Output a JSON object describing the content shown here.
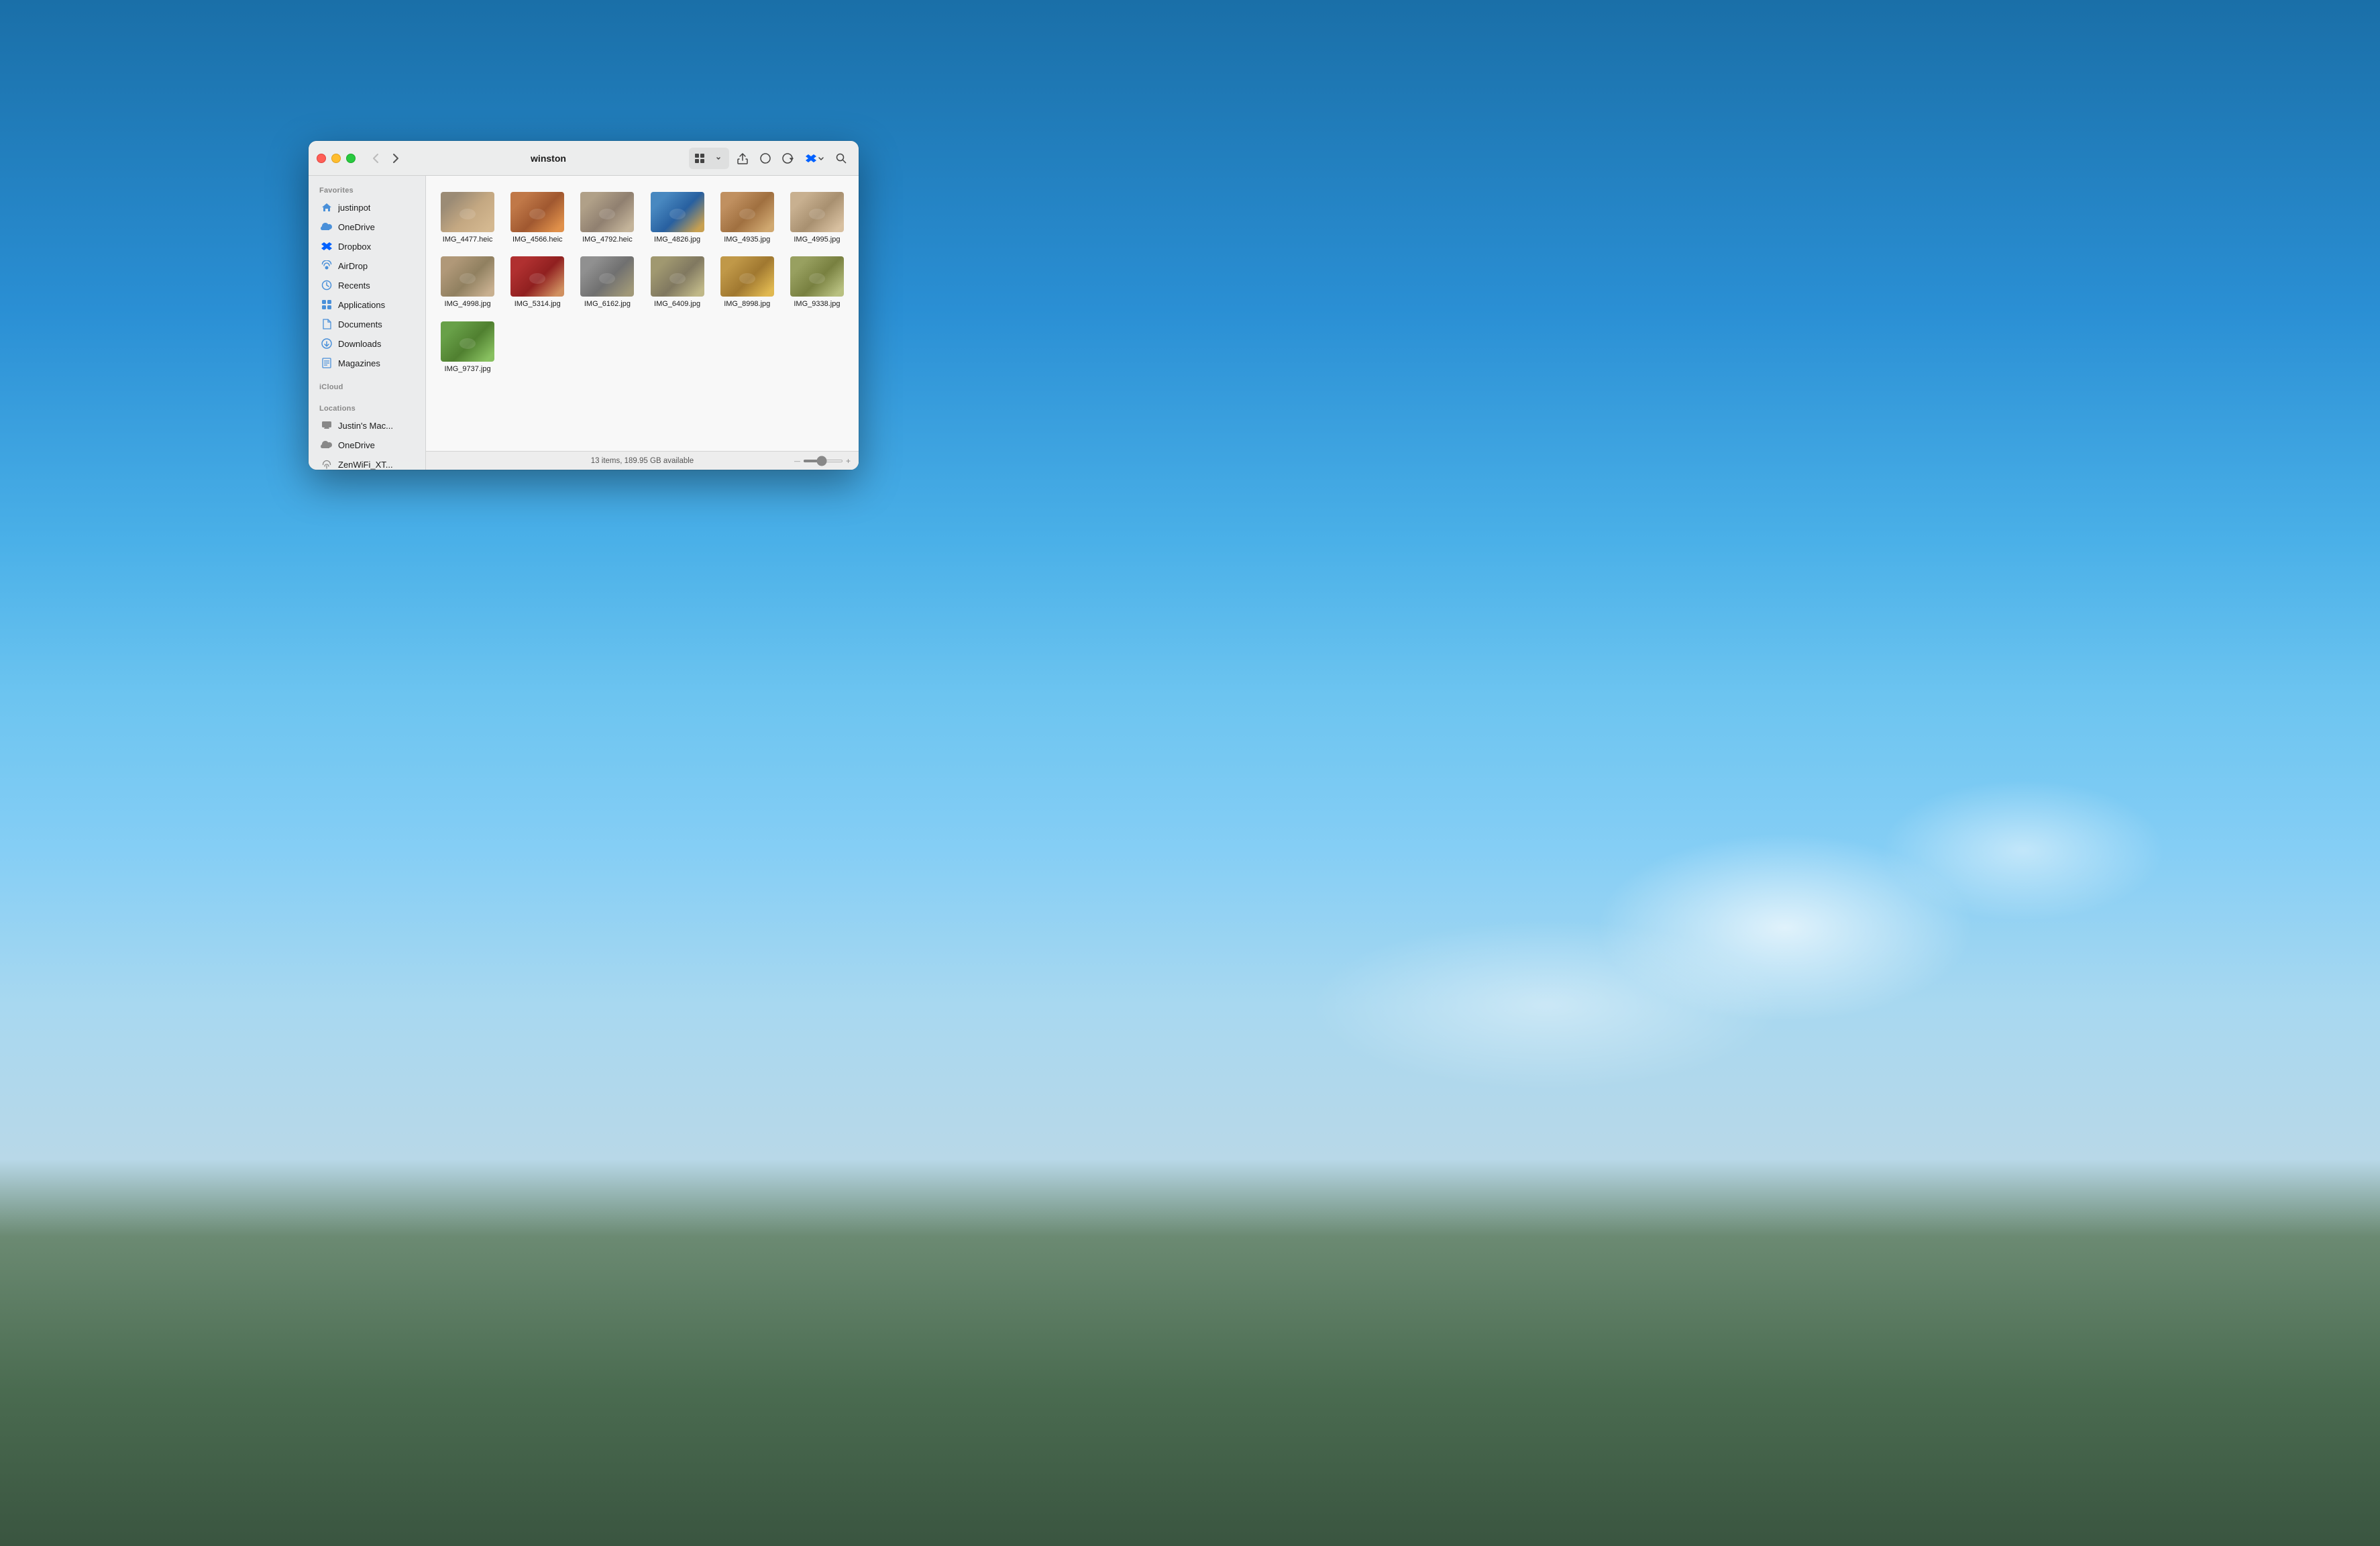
{
  "desktop": {
    "bg": "macOS desktop with ocean/sky scene"
  },
  "finder": {
    "title": "winston",
    "toolbar": {
      "back_label": "‹",
      "forward_label": "›",
      "view_grid_label": "⊞",
      "share_label": "↑",
      "tag_label": "⊙",
      "action_label": "…",
      "dropbox_label": "Dropbox",
      "search_label": "🔍"
    },
    "sidebar": {
      "favorites_label": "Favorites",
      "items": [
        {
          "id": "justinpot",
          "label": "justinpot",
          "icon": "🏠",
          "icon_color": "blue"
        },
        {
          "id": "onedrive",
          "label": "OneDrive",
          "icon": "☁",
          "icon_color": "blue"
        },
        {
          "id": "dropbox",
          "label": "Dropbox",
          "icon": "◈",
          "icon_color": "blue"
        },
        {
          "id": "airdrop",
          "label": "AirDrop",
          "icon": "📡",
          "icon_color": "blue"
        },
        {
          "id": "recents",
          "label": "Recents",
          "icon": "🕐",
          "icon_color": "blue"
        },
        {
          "id": "applications",
          "label": "Applications",
          "icon": "▦",
          "icon_color": "blue"
        },
        {
          "id": "documents",
          "label": "Documents",
          "icon": "📄",
          "icon_color": "blue"
        },
        {
          "id": "downloads",
          "label": "Downloads",
          "icon": "⬇",
          "icon_color": "blue"
        },
        {
          "id": "magazines",
          "label": "Magazines",
          "icon": "📰",
          "icon_color": "blue"
        }
      ],
      "locations_label": "Locations",
      "locations": [
        {
          "id": "justins-mac",
          "label": "Justin's Mac...",
          "icon": "💻",
          "icon_color": "gray"
        },
        {
          "id": "onedrive-loc",
          "label": "OneDrive",
          "icon": "☁",
          "icon_color": "gray"
        },
        {
          "id": "zenwifi",
          "label": "ZenWiFi_XT...",
          "icon": "📡",
          "icon_color": "gray"
        }
      ]
    },
    "icloud_label": "iCloud",
    "files": [
      {
        "name": "IMG_4477.heic",
        "color_class": "photo-dog-1"
      },
      {
        "name": "IMG_4566.heic",
        "color_class": "photo-dog-2"
      },
      {
        "name": "IMG_4792.heic",
        "color_class": "photo-dog-3"
      },
      {
        "name": "IMG_4826.jpg",
        "color_class": "photo-dog-4"
      },
      {
        "name": "IMG_4935.jpg",
        "color_class": "photo-dog-5"
      },
      {
        "name": "IMG_4995.jpg",
        "color_class": "photo-dog-6"
      },
      {
        "name": "IMG_4998.jpg",
        "color_class": "photo-dog-7"
      },
      {
        "name": "IMG_5314.jpg",
        "color_class": "photo-dog-8"
      },
      {
        "name": "IMG_6162.jpg",
        "color_class": "photo-dog-9"
      },
      {
        "name": "IMG_6409.jpg",
        "color_class": "photo-dog-10"
      },
      {
        "name": "IMG_8998.jpg",
        "color_class": "photo-dog-11"
      },
      {
        "name": "IMG_9338.jpg",
        "color_class": "photo-dog-12"
      },
      {
        "name": "IMG_9737.jpg",
        "color_class": "photo-dog-13"
      }
    ],
    "status": {
      "items_count": "13 items, 189.95 GB available"
    }
  }
}
